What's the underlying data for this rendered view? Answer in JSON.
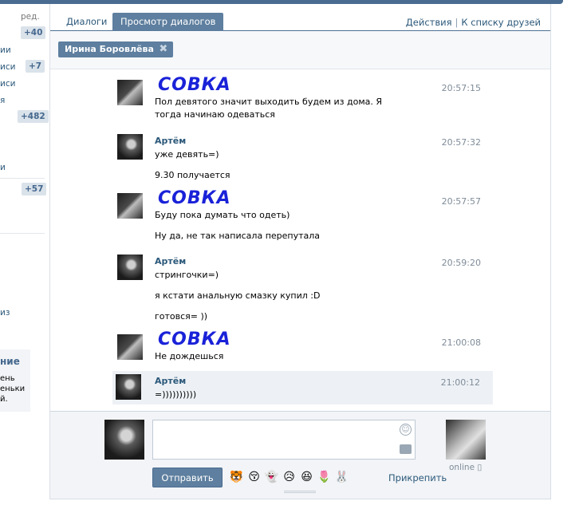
{
  "sidebar": {
    "red_label": "ред.",
    "badges": [
      "+40",
      "+7",
      "+482",
      "+57"
    ],
    "fragments": [
      "ии",
      "иси",
      "иси",
      "я",
      "и",
      "из"
    ],
    "box_title": "ние",
    "box_lines": [
      "ень",
      "еньки",
      "й."
    ]
  },
  "tabs": {
    "dialogs": "Диалоги",
    "view_dialogs": "Просмотр диалогов",
    "actions": "Действия",
    "separator": "|",
    "to_friends": "К списку друзей"
  },
  "filter": {
    "chip_label": "Ирина Боровлёва",
    "chip_close": "✖"
  },
  "messages": [
    {
      "author": "СОВКА",
      "scrawl": true,
      "time": "20:57:15",
      "lines": [
        "Пол девятого значит выходить будем из дома. Я тогда начинаю одеваться"
      ]
    },
    {
      "author": "Артём",
      "scrawl": false,
      "time": "20:57:32",
      "lines": [
        "уже девять=)",
        "9.30 получается"
      ]
    },
    {
      "author": "СОВКА",
      "scrawl": true,
      "time": "20:57:57",
      "lines": [
        "Буду пока думать что одеть)",
        "Ну да, не так написала перепутала"
      ]
    },
    {
      "author": "Артём",
      "scrawl": false,
      "time": "20:59:20",
      "lines": [
        "стрингочки=)",
        "я кстати анальную смазку купил :D",
        "готовся= ))"
      ]
    },
    {
      "author": "СОВКА",
      "scrawl": true,
      "time": "21:00:08",
      "lines": [
        "Не дождешься"
      ]
    },
    {
      "author": "Артём",
      "scrawl": false,
      "time": "21:00:12",
      "lines": [
        "=))))))))))"
      ]
    }
  ],
  "composer": {
    "send_label": "Отправить",
    "attach_label": "Прикрепить",
    "online_label": "online",
    "emojis": [
      "🐯",
      "😚",
      "👻",
      "😥",
      "😆",
      "🌷",
      "🐰"
    ]
  }
}
